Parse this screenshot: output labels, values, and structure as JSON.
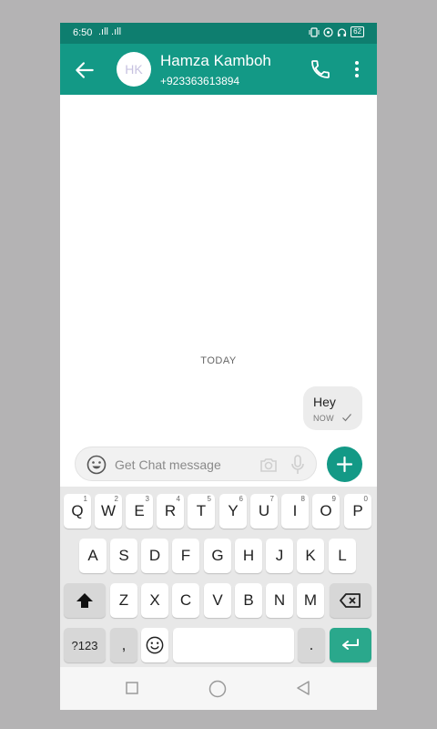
{
  "status_bar": {
    "time": "6:50",
    "signal": ".ıll .ıll",
    "battery": "62"
  },
  "header": {
    "avatar_initials": "HK",
    "contact_name": "Hamza Kamboh",
    "contact_phone": "+923363613894",
    "icons": [
      "back-arrow-icon",
      "phone-icon",
      "more-vert-icon"
    ]
  },
  "conversation": {
    "date_separator": "TODAY",
    "messages": [
      {
        "text": "Hey",
        "time": "NOW",
        "status": "sent-check-icon"
      }
    ]
  },
  "composer": {
    "placeholder": "Get Chat message",
    "icons": [
      "emoji-icon",
      "camera-icon",
      "mic-icon",
      "add-icon"
    ]
  },
  "keyboard": {
    "row1": [
      {
        "label": "Q",
        "sup": "1"
      },
      {
        "label": "W",
        "sup": "2"
      },
      {
        "label": "E",
        "sup": "3"
      },
      {
        "label": "R",
        "sup": "4"
      },
      {
        "label": "T",
        "sup": "5"
      },
      {
        "label": "Y",
        "sup": "6"
      },
      {
        "label": "U",
        "sup": "7"
      },
      {
        "label": "I",
        "sup": "8"
      },
      {
        "label": "O",
        "sup": "9"
      },
      {
        "label": "P",
        "sup": "0"
      }
    ],
    "row2": [
      "A",
      "S",
      "D",
      "F",
      "G",
      "H",
      "J",
      "K",
      "L"
    ],
    "row3": [
      "Z",
      "X",
      "C",
      "V",
      "B",
      "N",
      "M"
    ],
    "row4": {
      "symbols": "?123",
      "comma": ",",
      "period": "."
    },
    "accent_color": "#2aa88c"
  },
  "colors": {
    "app_bar": "#139986",
    "status_bar": "#0e7e6f",
    "background": "#b4b3b4"
  }
}
